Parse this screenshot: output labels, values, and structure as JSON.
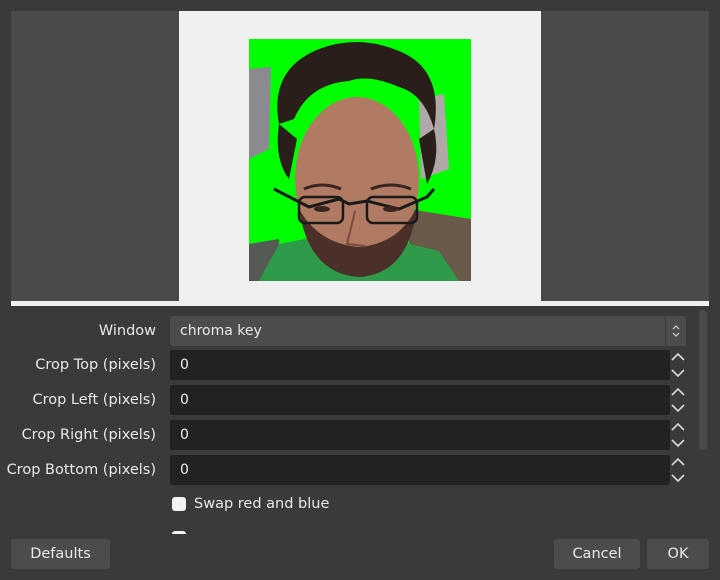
{
  "properties": {
    "window": {
      "label": "Window",
      "value": "chroma key"
    },
    "crop_top": {
      "label": "Crop Top (pixels)",
      "value": "0"
    },
    "crop_left": {
      "label": "Crop Left (pixels)",
      "value": "0"
    },
    "crop_right": {
      "label": "Crop Right (pixels)",
      "value": "0"
    },
    "crop_bottom": {
      "label": "Crop Bottom (pixels)",
      "value": "0"
    },
    "swap_red_blue": {
      "label": "Swap red and blue",
      "checked": false
    }
  },
  "buttons": {
    "defaults": "Defaults",
    "cancel": "Cancel",
    "ok": "OK"
  },
  "colors": {
    "background": "#3a3a3a",
    "chroma_green": "#00ff00",
    "field_bg": "#222222",
    "button_bg": "#4c4c4c"
  }
}
